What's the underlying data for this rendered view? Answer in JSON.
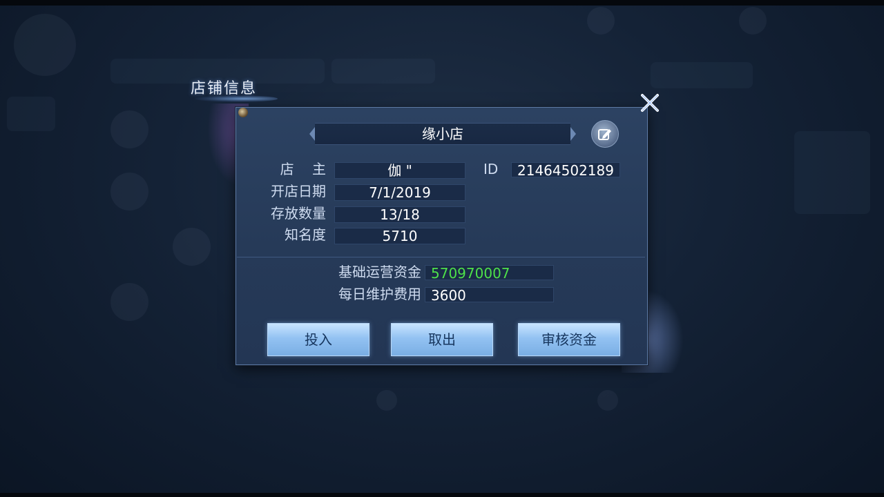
{
  "window": {
    "title": "店铺信息"
  },
  "shop": {
    "name": "缘小店",
    "owner_label": "店　 主",
    "owner_value": "伽 \"",
    "id_label": "ID",
    "id_value": "21464502189",
    "open_date_label": "开店日期",
    "open_date_value": "7/1/2019",
    "storage_label": "存放数量",
    "storage_value": "13/18",
    "fame_label": "知名度",
    "fame_value": "5710"
  },
  "funds": {
    "base_funds_label": "基础运营资金",
    "base_funds_value": "570970007",
    "daily_fee_label": "每日维护费用",
    "daily_fee_value": "3600"
  },
  "buttons": {
    "deposit": "投入",
    "withdraw": "取出",
    "audit": "审核资金"
  },
  "colors": {
    "funds_value": "#4ee04a",
    "panel_bg": "#2a3f5f",
    "button_bg": "#93c2f2"
  },
  "icons": {
    "close": "close-icon",
    "edit": "edit-icon"
  }
}
